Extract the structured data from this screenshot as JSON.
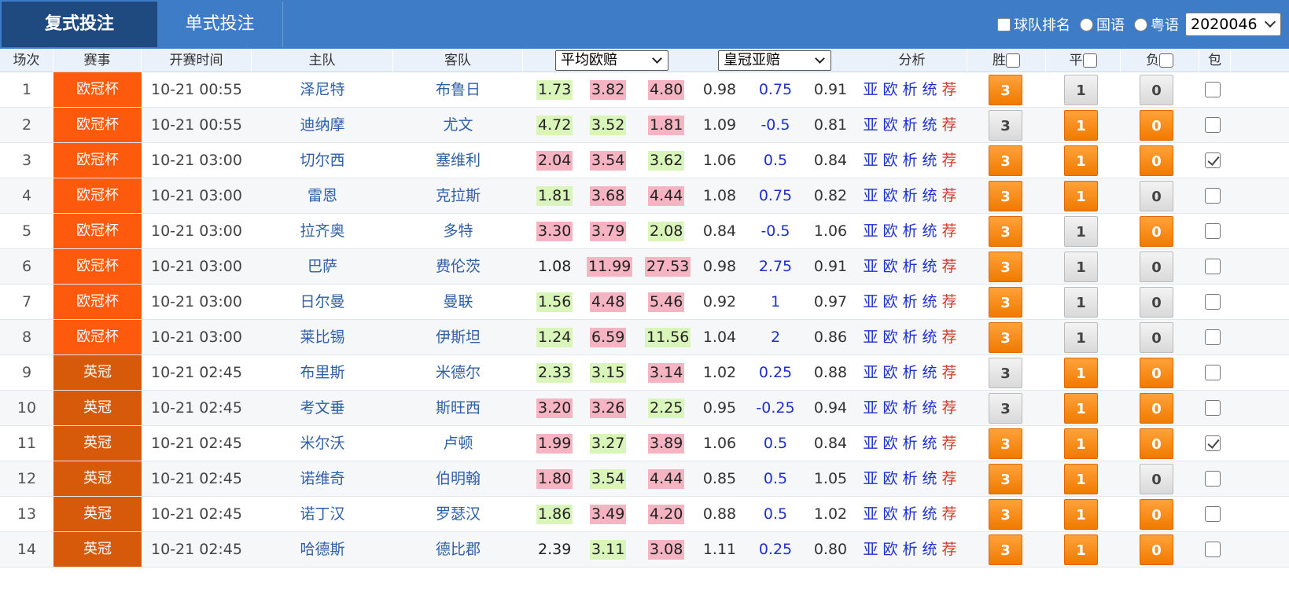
{
  "tabs": {
    "active": "复式投注",
    "other": "单式投注"
  },
  "options": {
    "rank_label": "球队排名",
    "mandarin_label": "国语",
    "cantonese_label": "粤语",
    "period": "2020046"
  },
  "headers": {
    "index": "场次",
    "league": "赛事",
    "time": "开赛时间",
    "home": "主队",
    "away": "客队",
    "euro_select": "平均欧赔",
    "asia_select": "皇冠亚赔",
    "analysis": "分析",
    "win": "胜",
    "draw": "平",
    "loss": "负",
    "bao": "包"
  },
  "colors": {
    "euro_cup": "#fe5a0e",
    "championship": "#d65a0a",
    "odds_green": "#d9f5b9",
    "odds_pink": "#f6b3c2",
    "pick_on": "#f27f08"
  },
  "analysis_links": [
    "亚",
    "欧",
    "析",
    "统",
    "荐"
  ],
  "rows": [
    {
      "idx": "1",
      "league": "欧冠杯",
      "lcolor": "euro",
      "time": "10-21 00:55",
      "home": "泽尼特",
      "away": "布鲁日",
      "o1": "1.73",
      "o1c": "green",
      "o2": "3.82",
      "o2c": "pink",
      "o3": "4.80",
      "o3c": "pink",
      "a1": "0.98",
      "hcp": "0.75",
      "a2": "0.91",
      "win": "3",
      "win_on": true,
      "draw": "1",
      "draw_on": false,
      "loss": "0",
      "loss_on": false,
      "bao": false
    },
    {
      "idx": "2",
      "league": "欧冠杯",
      "lcolor": "euro",
      "time": "10-21 00:55",
      "home": "迪纳摩",
      "away": "尤文",
      "o1": "4.72",
      "o1c": "green",
      "o2": "3.52",
      "o2c": "green",
      "o3": "1.81",
      "o3c": "pink",
      "a1": "1.09",
      "hcp": "-0.5",
      "a2": "0.81",
      "win": "3",
      "win_on": false,
      "draw": "1",
      "draw_on": true,
      "loss": "0",
      "loss_on": true,
      "bao": false
    },
    {
      "idx": "3",
      "league": "欧冠杯",
      "lcolor": "euro",
      "time": "10-21 03:00",
      "home": "切尔西",
      "away": "塞维利",
      "o1": "2.04",
      "o1c": "pink",
      "o2": "3.54",
      "o2c": "pink",
      "o3": "3.62",
      "o3c": "green",
      "a1": "1.06",
      "hcp": "0.5",
      "a2": "0.84",
      "win": "3",
      "win_on": true,
      "draw": "1",
      "draw_on": true,
      "loss": "0",
      "loss_on": true,
      "bao": true
    },
    {
      "idx": "4",
      "league": "欧冠杯",
      "lcolor": "euro",
      "time": "10-21 03:00",
      "home": "雷恩",
      "away": "克拉斯",
      "o1": "1.81",
      "o1c": "green",
      "o2": "3.68",
      "o2c": "pink",
      "o3": "4.44",
      "o3c": "pink",
      "a1": "1.08",
      "hcp": "0.75",
      "a2": "0.82",
      "win": "3",
      "win_on": true,
      "draw": "1",
      "draw_on": true,
      "loss": "0",
      "loss_on": false,
      "bao": false
    },
    {
      "idx": "5",
      "league": "欧冠杯",
      "lcolor": "euro",
      "time": "10-21 03:00",
      "home": "拉齐奥",
      "away": "多特",
      "o1": "3.30",
      "o1c": "pink",
      "o2": "3.79",
      "o2c": "pink",
      "o3": "2.08",
      "o3c": "green",
      "a1": "0.84",
      "hcp": "-0.5",
      "a2": "1.06",
      "win": "3",
      "win_on": true,
      "draw": "1",
      "draw_on": false,
      "loss": "0",
      "loss_on": true,
      "bao": false
    },
    {
      "idx": "6",
      "league": "欧冠杯",
      "lcolor": "euro",
      "time": "10-21 03:00",
      "home": "巴萨",
      "away": "费伦茨",
      "o1": "1.08",
      "o1c": "none",
      "o2": "11.99",
      "o2c": "pink",
      "o3": "27.53",
      "o3c": "pink",
      "a1": "0.98",
      "hcp": "2.75",
      "a2": "0.91",
      "win": "3",
      "win_on": true,
      "draw": "1",
      "draw_on": false,
      "loss": "0",
      "loss_on": false,
      "bao": false
    },
    {
      "idx": "7",
      "league": "欧冠杯",
      "lcolor": "euro",
      "time": "10-21 03:00",
      "home": "日尔曼",
      "away": "曼联",
      "o1": "1.56",
      "o1c": "green",
      "o2": "4.48",
      "o2c": "pink",
      "o3": "5.46",
      "o3c": "pink",
      "a1": "0.92",
      "hcp": "1",
      "a2": "0.97",
      "win": "3",
      "win_on": true,
      "draw": "1",
      "draw_on": false,
      "loss": "0",
      "loss_on": false,
      "bao": false
    },
    {
      "idx": "8",
      "league": "欧冠杯",
      "lcolor": "euro",
      "time": "10-21 03:00",
      "home": "莱比锡",
      "away": "伊斯坦",
      "o1": "1.24",
      "o1c": "green",
      "o2": "6.59",
      "o2c": "pink",
      "o3": "11.56",
      "o3c": "green",
      "a1": "1.04",
      "hcp": "2",
      "a2": "0.86",
      "win": "3",
      "win_on": true,
      "draw": "1",
      "draw_on": false,
      "loss": "0",
      "loss_on": false,
      "bao": false
    },
    {
      "idx": "9",
      "league": "英冠",
      "lcolor": "champ",
      "time": "10-21 02:45",
      "home": "布里斯",
      "away": "米德尔",
      "o1": "2.33",
      "o1c": "green",
      "o2": "3.15",
      "o2c": "green",
      "o3": "3.14",
      "o3c": "pink",
      "a1": "1.02",
      "hcp": "0.25",
      "a2": "0.88",
      "win": "3",
      "win_on": false,
      "draw": "1",
      "draw_on": true,
      "loss": "0",
      "loss_on": true,
      "bao": false
    },
    {
      "idx": "10",
      "league": "英冠",
      "lcolor": "champ",
      "time": "10-21 02:45",
      "home": "考文垂",
      "away": "斯旺西",
      "o1": "3.20",
      "o1c": "pink",
      "o2": "3.26",
      "o2c": "pink",
      "o3": "2.25",
      "o3c": "green",
      "a1": "0.95",
      "hcp": "-0.25",
      "a2": "0.94",
      "win": "3",
      "win_on": false,
      "draw": "1",
      "draw_on": true,
      "loss": "0",
      "loss_on": true,
      "bao": false
    },
    {
      "idx": "11",
      "league": "英冠",
      "lcolor": "champ",
      "time": "10-21 02:45",
      "home": "米尔沃",
      "away": "卢顿",
      "o1": "1.99",
      "o1c": "pink",
      "o2": "3.27",
      "o2c": "green",
      "o3": "3.89",
      "o3c": "pink",
      "a1": "1.06",
      "hcp": "0.5",
      "a2": "0.84",
      "win": "3",
      "win_on": true,
      "draw": "1",
      "draw_on": true,
      "loss": "0",
      "loss_on": true,
      "bao": true
    },
    {
      "idx": "12",
      "league": "英冠",
      "lcolor": "champ",
      "time": "10-21 02:45",
      "home": "诺维奇",
      "away": "伯明翰",
      "o1": "1.80",
      "o1c": "pink",
      "o2": "3.54",
      "o2c": "green",
      "o3": "4.44",
      "o3c": "pink",
      "a1": "0.85",
      "hcp": "0.5",
      "a2": "1.05",
      "win": "3",
      "win_on": true,
      "draw": "1",
      "draw_on": true,
      "loss": "0",
      "loss_on": false,
      "bao": false
    },
    {
      "idx": "13",
      "league": "英冠",
      "lcolor": "champ",
      "time": "10-21 02:45",
      "home": "诺丁汉",
      "away": "罗瑟汉",
      "o1": "1.86",
      "o1c": "green",
      "o2": "3.49",
      "o2c": "pink",
      "o3": "4.20",
      "o3c": "pink",
      "a1": "0.88",
      "hcp": "0.5",
      "a2": "1.02",
      "win": "3",
      "win_on": true,
      "draw": "1",
      "draw_on": true,
      "loss": "0",
      "loss_on": true,
      "bao": false
    },
    {
      "idx": "14",
      "league": "英冠",
      "lcolor": "champ",
      "time": "10-21 02:45",
      "home": "哈德斯",
      "away": "德比郡",
      "o1": "2.39",
      "o1c": "none",
      "o2": "3.11",
      "o2c": "green",
      "o3": "3.08",
      "o3c": "pink",
      "a1": "1.11",
      "hcp": "0.25",
      "a2": "0.80",
      "win": "3",
      "win_on": true,
      "draw": "1",
      "draw_on": true,
      "loss": "0",
      "loss_on": true,
      "bao": false
    }
  ]
}
